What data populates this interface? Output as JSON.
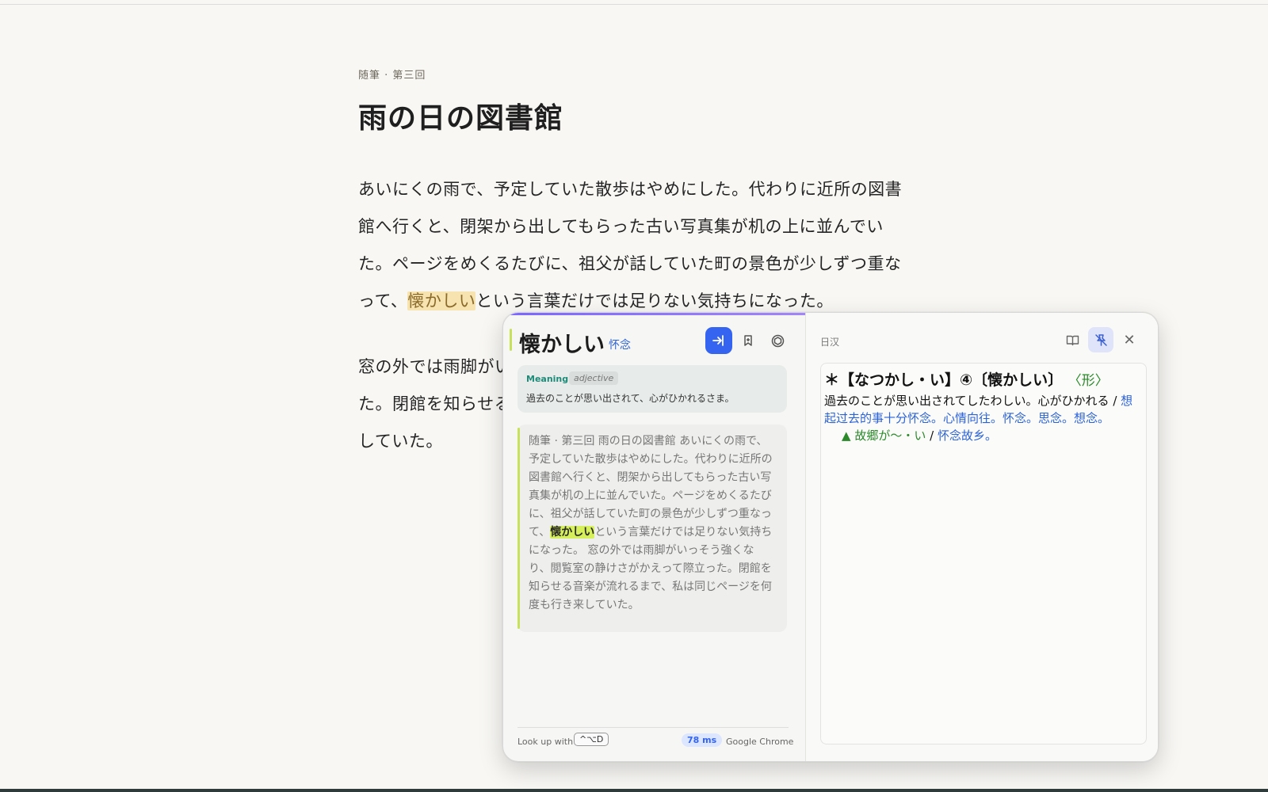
{
  "article": {
    "kicker": "随筆 · 第三回",
    "title": "雨の日の図書館",
    "para1_before": "あいにくの雨で、予定していた散歩はやめにした。代わりに近所の図書館へ行くと、閉架から出してもらった古い写真集が机の上に並んでいた。ページをめくるたびに、祖父が話していた町の景色が少しずつ重なって、",
    "para1_highlight": "懐かしい",
    "para1_after": "という言葉だけでは足りない気持ちになった。",
    "para2": "窓の外では雨脚がいっそう強くなり、閲覧室の静けさがかえって際立った。閉館を知らせる音楽が流れるまで、私は同じページを何度も行き来していた。"
  },
  "popup": {
    "word": "懐かしい",
    "reading": "怀念",
    "buttons": {
      "lookup_icon": "enter-icon",
      "bookmark_icon": "bookmark-icon",
      "cube_icon": "cube-icon"
    },
    "meaning": {
      "label": "Meaning",
      "pos": "adjective",
      "text": "過去のことが思い出されて、心がひかれるさま。"
    },
    "context": {
      "before": "随筆 · 第三回 雨の日の図書館 あいにくの雨で、予定していた散歩はやめにした。代わりに近所の図書館へ行くと、閉架から出してもらった古い写真集が机の上に並んでいた。ページをめくるたびに、祖父が話していた町の景色が少しずつ重なって、",
      "highlight": "懐かしい",
      "after": "という言葉だけでは足りない気持ちになった。 窓の外では雨脚がいっそう強くなり、閲覧室の静けさがかえって際立った。閉館を知らせる音楽が流れるまで、私は同じページを何度も行き来していた。"
    },
    "footer": {
      "lookup_label": "Look up with",
      "shortcut": "^⌥D",
      "latency": "78 ms",
      "browser": "Google Chrome"
    },
    "dictionary": {
      "label": "日汉",
      "headword": "＊【なつかし・い】④〔懐かしい〕",
      "pos": "〈形〉",
      "definition_ja": "過去のことが思い出されてしたわしい。心がひかれる",
      "slash1": " / ",
      "definition_zh": "想起过去的事十分怀念。心情向往。怀念。思念。想念。",
      "example_marker": "▲",
      "example_ja": "故郷が〜・い",
      "slash2": " / ",
      "example_zh": "怀念故乡。"
    },
    "colors": {
      "accent_blue": "#3564f0",
      "highlight_yellow": "#f6e3b0",
      "context_highlight": "#d6f05b",
      "green": "#2a8a2a"
    }
  }
}
